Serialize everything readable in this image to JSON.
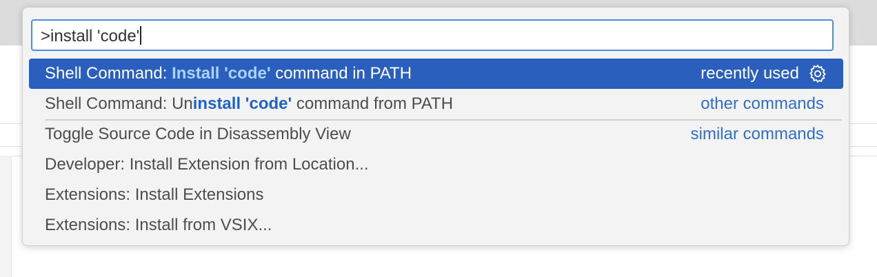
{
  "command_palette": {
    "input_value": ">install 'code'",
    "items": [
      {
        "prefix": "Shell Command: ",
        "highlight": "Install 'code'",
        "suffix": " command in PATH",
        "group": "recently used"
      },
      {
        "prefix": "Shell Command: Un",
        "highlight": "install 'code'",
        "suffix": " command from PATH",
        "group": "other commands"
      },
      {
        "label": "Toggle Source Code in Disassembly View",
        "group": "similar commands"
      },
      {
        "label": "Developer: Install Extension from Location..."
      },
      {
        "label": "Extensions: Install Extensions"
      },
      {
        "label": "Extensions: Install from VSIX..."
      }
    ]
  },
  "colors": {
    "selection_background": "#2b5fbe",
    "highlight_text": "#1f63c6",
    "group_label": "#2f6fc8",
    "input_border": "#4d8fdb"
  },
  "icons": {
    "selected_item_action": "gear-icon"
  }
}
